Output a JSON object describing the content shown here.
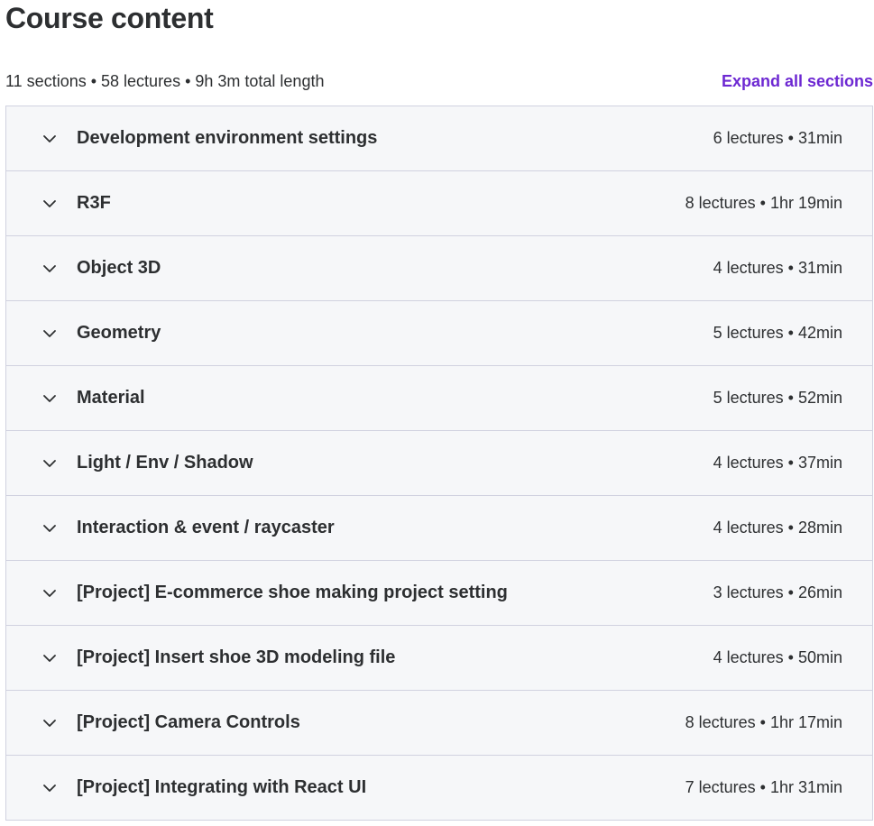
{
  "header": {
    "title": "Course content"
  },
  "summary": {
    "text": "11 sections • 58 lectures • 9h 3m total length",
    "expand_label": "Expand all sections"
  },
  "colors": {
    "accent": "#6d28d2",
    "text": "#2d2f31",
    "section_bg": "#f6f7f9",
    "border": "#d1d2e0"
  },
  "sections": [
    {
      "title": "Development environment settings",
      "meta": "6 lectures • 31min",
      "icon": "chevron-down-icon"
    },
    {
      "title": "R3F",
      "meta": "8 lectures • 1hr 19min",
      "icon": "chevron-down-icon"
    },
    {
      "title": "Object 3D",
      "meta": "4 lectures • 31min",
      "icon": "chevron-down-icon"
    },
    {
      "title": "Geometry",
      "meta": "5 lectures • 42min",
      "icon": "chevron-down-icon"
    },
    {
      "title": "Material",
      "meta": "5 lectures • 52min",
      "icon": "chevron-down-icon"
    },
    {
      "title": "Light / Env / Shadow",
      "meta": "4 lectures • 37min",
      "icon": "chevron-down-icon"
    },
    {
      "title": "Interaction & event / raycaster",
      "meta": "4 lectures • 28min",
      "icon": "chevron-down-icon"
    },
    {
      "title": "[Project] E-commerce shoe making project setting",
      "meta": "3 lectures • 26min",
      "icon": "chevron-down-icon"
    },
    {
      "title": "[Project] Insert shoe 3D modeling file",
      "meta": "4 lectures • 50min",
      "icon": "chevron-down-icon"
    },
    {
      "title": "[Project] Camera Controls",
      "meta": "8 lectures • 1hr 17min",
      "icon": "chevron-down-icon"
    },
    {
      "title": "[Project] Integrating with React UI",
      "meta": "7 lectures • 1hr 31min",
      "icon": "chevron-down-icon"
    }
  ]
}
